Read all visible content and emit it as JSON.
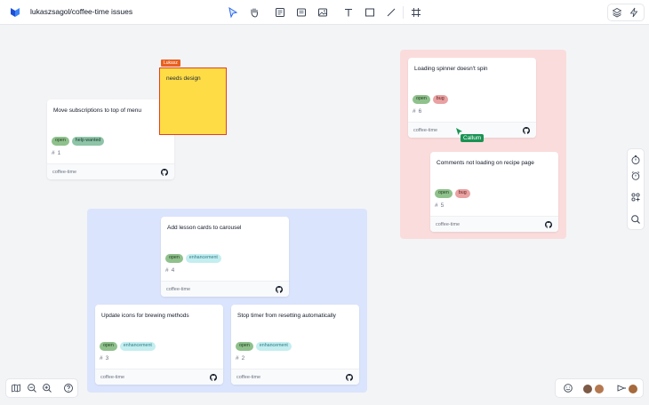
{
  "header": {
    "title": "lukaszsagol/coffee-time issues",
    "tools": [
      "select-icon",
      "hand-icon",
      "sticky-note-icon",
      "card-icon",
      "image-icon",
      "text-icon",
      "rectangle-icon",
      "line-icon",
      "frame-icon"
    ],
    "right_tools": [
      "layers-icon",
      "lightning-icon"
    ]
  },
  "sticky": {
    "owner": "Lukasz",
    "text": "needs design",
    "color": "#fddc46"
  },
  "cards": [
    {
      "title": "Move subscriptions to top of menu",
      "tags": [
        {
          "label": "open",
          "kind": "open"
        },
        {
          "label": "help wanted",
          "kind": "help"
        }
      ],
      "number": "1",
      "repo": "coffee-time"
    },
    {
      "title": "Add lesson cards to carousel",
      "tags": [
        {
          "label": "open",
          "kind": "open"
        },
        {
          "label": "enhancement",
          "kind": "enh"
        }
      ],
      "number": "4",
      "repo": "coffee-time"
    },
    {
      "title": "Update icons for brewing methods",
      "tags": [
        {
          "label": "open",
          "kind": "open"
        },
        {
          "label": "enhancement",
          "kind": "enh"
        }
      ],
      "number": "3",
      "repo": "coffee-time"
    },
    {
      "title": "Stop timer from resetting automatically",
      "tags": [
        {
          "label": "open",
          "kind": "open"
        },
        {
          "label": "enhancement",
          "kind": "enh"
        }
      ],
      "number": "2",
      "repo": "coffee-time"
    },
    {
      "title": "Loading spinner doesn't spin",
      "tags": [
        {
          "label": "open",
          "kind": "open"
        },
        {
          "label": "bug",
          "kind": "bug"
        }
      ],
      "number": "6",
      "repo": "coffee-time"
    },
    {
      "title": "Comments not loading on recipe page",
      "tags": [
        {
          "label": "open",
          "kind": "open"
        },
        {
          "label": "bug",
          "kind": "bug"
        }
      ],
      "number": "5",
      "repo": "coffee-time"
    }
  ],
  "collaborator_cursor": {
    "name": "Callum",
    "color": "#199353"
  },
  "side_panel": [
    "timer-icon",
    "alarm-icon",
    "apps-icon",
    "search-icon"
  ],
  "bottom_left": [
    "map-icon",
    "zoom-out-icon",
    "zoom-in-icon",
    "help-icon"
  ],
  "bottom_right": [
    "reaction-icon",
    "avatar",
    "avatar",
    "present-icon",
    "avatar"
  ],
  "colors": {
    "accent": "#2563eb",
    "blue_zone": "#dbe4fd",
    "red_zone": "#fbdcdc",
    "open_tag": "#8fc18c"
  }
}
